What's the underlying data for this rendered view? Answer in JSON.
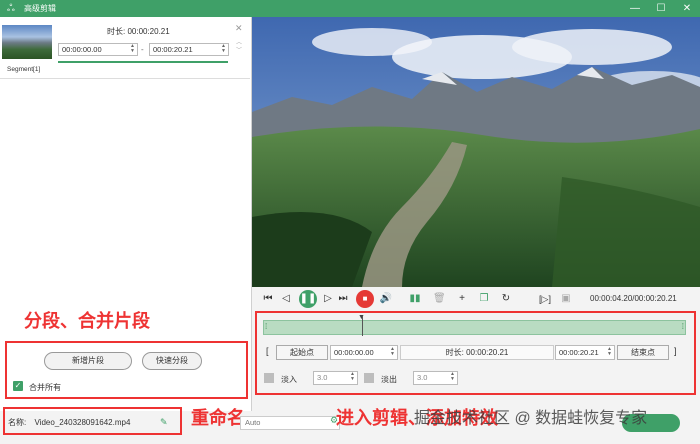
{
  "window": {
    "title": "高级剪辑",
    "app_icon": "rabbit-app-icon",
    "controls": {
      "minimize": "—",
      "maximize": "☐",
      "close": "✕"
    },
    "accent": "#3fa068"
  },
  "segment_card": {
    "duration_label": "时长: 00:00:20.21",
    "start_time": "00:00:00.00",
    "end_time": "00:00:20.21",
    "dash": "-",
    "label": "Segment[1]"
  },
  "segment_actions": {
    "new_segment": "新增片段",
    "quick_split": "快速分段",
    "merge_all": "合并所有",
    "merge_all_checked": true
  },
  "annotations": {
    "segment_merge": "分段、合并片段",
    "rename": "重命名",
    "enter_edit": "进入剪辑、添加特效"
  },
  "player": {
    "timecode": "00:00:04.20/00:00:20.21"
  },
  "trim": {
    "start_button": "起始点",
    "start_value": "00:00:00.00",
    "duration_label": "时长: 00:00:20.21",
    "end_value": "00:00:20.21",
    "end_button": "结束点",
    "bracket_left": "[",
    "bracket_right": "]",
    "fade_in_label": "淡入",
    "fade_in_value": "3.0",
    "fade_out_label": "淡出",
    "fade_out_value": "3.0"
  },
  "bottom": {
    "name_label": "名称:",
    "file_name": "Video_240328091642.mp4",
    "hidden_field": "Auto",
    "watermark": "掘金技术社区 @ 数据蛙恢复专家"
  }
}
